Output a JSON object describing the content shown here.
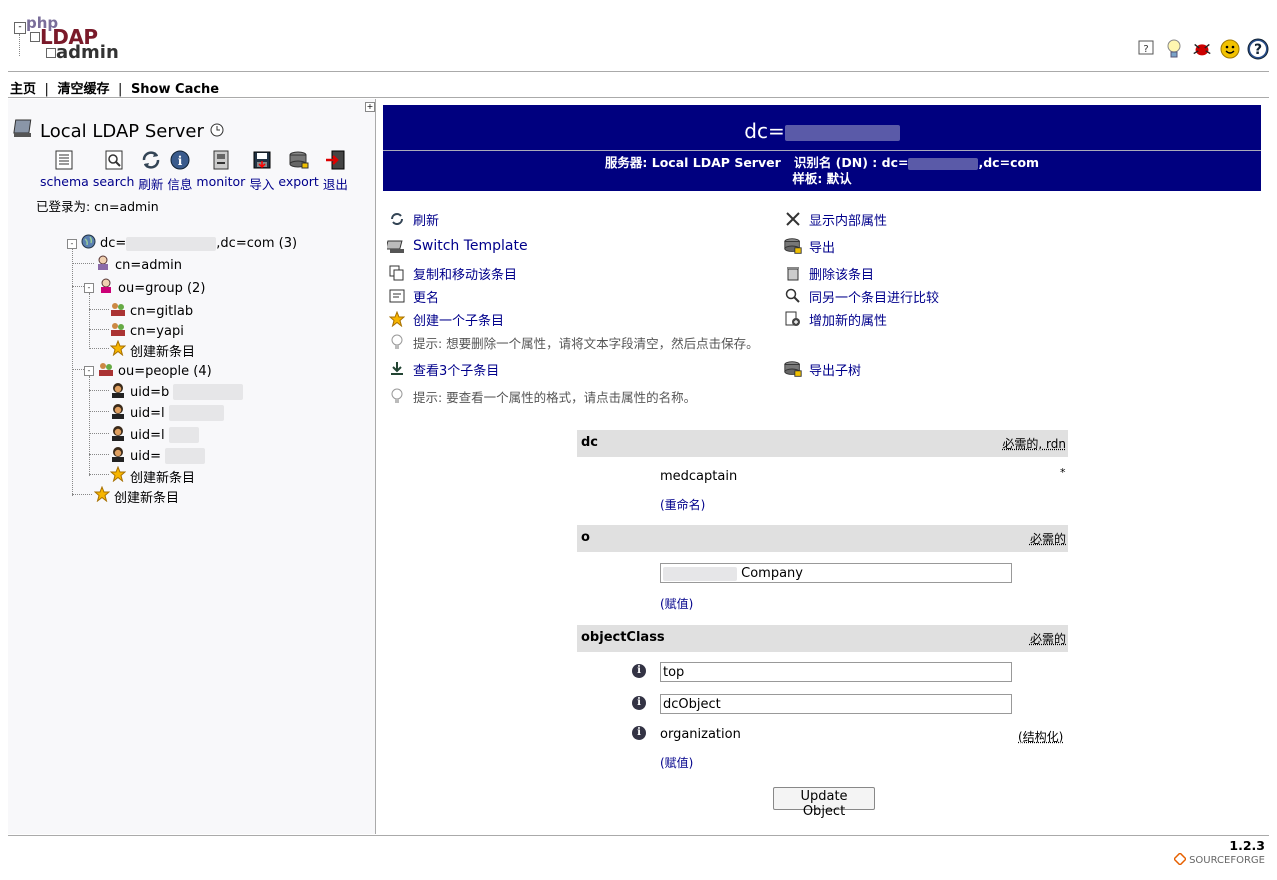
{
  "logo": {
    "line1": "php",
    "line2": "LDAP",
    "line3": "admin"
  },
  "menu": {
    "home": "主页",
    "purge": "清空缓存",
    "show_cache": "Show Cache",
    "sep": "|"
  },
  "server": {
    "title": "Local LDAP Server"
  },
  "toolbar": [
    {
      "label": "schema",
      "icon": "schema-icon"
    },
    {
      "label": "search",
      "icon": "search-icon"
    },
    {
      "label": "刷新",
      "icon": "refresh-icon"
    },
    {
      "label": "信息",
      "icon": "info-icon"
    },
    {
      "label": "monitor",
      "icon": "monitor-icon"
    },
    {
      "label": "导入",
      "icon": "import-icon"
    },
    {
      "label": "export",
      "icon": "export-icon"
    },
    {
      "label": "退出",
      "icon": "logout-icon"
    }
  ],
  "logged_in": "已登录为: cn=admin",
  "tree": {
    "root_prefix": "dc=",
    "root_suffix": ",dc=com (3)",
    "cn_admin": "cn=admin",
    "ou_group": "ou=group (2)",
    "cn_gitlab": "cn=gitlab",
    "cn_yapi": "cn=yapi",
    "create_new": "创建新条目",
    "ou_people": "ou=people (4)",
    "uid1": "uid=b",
    "uid2": "uid=l",
    "uid3": "uid=l",
    "uid4": "uid=",
    "create_new_people": "创建新条目",
    "create_new_root": "创建新条目"
  },
  "dn_header": {
    "title": "dc=",
    "server_label": "服务器: Local LDAP Server",
    "dn_label": "识别名 (DN) : dc=",
    "dn_suffix": ",dc=com",
    "template_label": "样板: 默认"
  },
  "actions": {
    "refresh": "刷新",
    "switch_template": "Switch Template",
    "copy_move": "复制和移动该条目",
    "rename": "更名",
    "create_child": "创建一个子条目",
    "hint1": "提示:  想要删除一个属性，请将文本字段清空，然后点击保存。",
    "view_children": "查看3个子条目",
    "hint2": "提示:  要查看一个属性的格式，请点击属性的名称。",
    "show_internal": "显示内部属性",
    "export": "导出",
    "delete": "删除该条目",
    "compare": "同另一个条目进行比较",
    "add_attr": "增加新的属性",
    "export_subtree": "导出子树"
  },
  "attrs": {
    "dc": {
      "name": "dc",
      "req": "必需的, rdn",
      "value": "medcaptain",
      "star": "*",
      "link": "(重命名)"
    },
    "o": {
      "name": "o",
      "req": "必需的",
      "value": "Company",
      "link": "(赋值)"
    },
    "objectClass": {
      "name": "objectClass",
      "req": "必需的",
      "v1": "top",
      "v2": "dcObject",
      "v3": "organization",
      "v3_note": "(结构化)",
      "link": "(赋值)"
    }
  },
  "update_button": "Update Object",
  "footer": {
    "version": "1.2.3",
    "sf": "SOURCEFORGE"
  }
}
